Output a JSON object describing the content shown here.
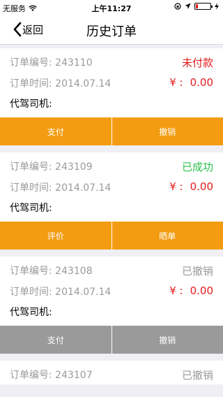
{
  "status_bar": {
    "carrier": "无服务",
    "time": "上午11:27"
  },
  "nav": {
    "back_label": "返回",
    "title": "历史订单"
  },
  "orders": [
    {
      "number_label": "订单编号:  243110",
      "status": "未付款",
      "status_color": "#e11b1b",
      "time_label": "订单时间:  2014.07.14",
      "amount_prefix": "¥ :",
      "amount": "0.00",
      "driver_label": "代驾司机:",
      "actions": [
        "支付",
        "撤销"
      ],
      "action_color": "#f39c12"
    },
    {
      "number_label": "订单编号:  243109",
      "status": "已成功",
      "status_color": "#2bbf4a",
      "time_label": "订单时间:  2014.07.14",
      "amount_prefix": "¥ :",
      "amount": "0.00",
      "driver_label": "代驾司机:",
      "actions": [
        "评价",
        "晒单"
      ],
      "action_color": "#f39c12"
    },
    {
      "number_label": "订单编号:  243108",
      "status": "已撤销",
      "status_color": "#9a9a9a",
      "time_label": "订单时间:  2014.07.14",
      "amount_prefix": "¥ :",
      "amount": "0.00",
      "driver_label": "代驾司机:",
      "actions": [
        "支付",
        "撤销"
      ],
      "action_color": "#9a9a9a"
    },
    {
      "number_label": "订单编号:  243107",
      "status": "已撤销",
      "status_color": "#9a9a9a"
    }
  ]
}
